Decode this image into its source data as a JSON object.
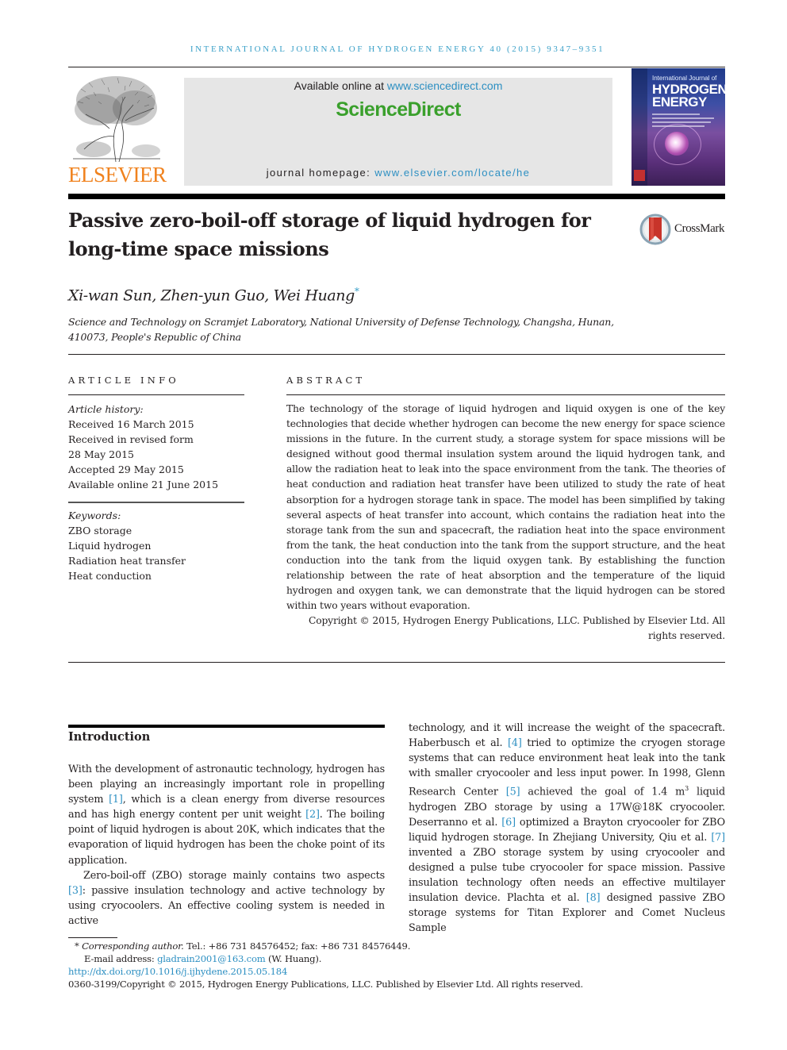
{
  "running_head": "INTERNATIONAL JOURNAL OF HYDROGEN ENERGY 40 (2015) 9347–9351",
  "masthead": {
    "publisher_logo_text": "ELSEVIER",
    "available_online_prefix": "Available online at ",
    "available_online_link": "www.sciencedirect.com",
    "platform_name": "ScienceDirect",
    "homepage_prefix": "journal homepage: ",
    "homepage_link": "www.elsevier.com/locate/he",
    "cover": {
      "line1": "International Journal of",
      "line2": "HYDROGEN",
      "line3": "ENERGY"
    },
    "colors": {
      "publisher_orange": "#f0821e",
      "platform_green": "#3aa02c",
      "link_blue": "#2c8fc2"
    }
  },
  "article": {
    "title": "Passive zero-boil-off storage of liquid hydrogen for long-time space missions",
    "crossmark_label": "CrossMark",
    "authors": "Xi-wan Sun, Zhen-yun Guo, Wei Huang",
    "corresponding_marker": "*",
    "affiliation": "Science and Technology on Scramjet Laboratory, National University of Defense Technology, Changsha, Hunan, 410073, People's Republic of China"
  },
  "article_info": {
    "heading": "ARTICLE INFO",
    "history_label": "Article history:",
    "history": [
      "Received 16 March 2015",
      "Received in revised form",
      "28 May 2015",
      "Accepted 29 May 2015",
      "Available online 21 June 2015"
    ],
    "keywords_label": "Keywords:",
    "keywords": [
      "ZBO storage",
      "Liquid hydrogen",
      "Radiation heat transfer",
      "Heat conduction"
    ]
  },
  "abstract": {
    "heading": "ABSTRACT",
    "body": "The technology of the storage of liquid hydrogen and liquid oxygen is one of the key technologies that decide whether hydrogen can become the new energy for space science missions in the future. In the current study, a storage system for space missions will be designed without good thermal insulation system around the liquid hydrogen tank, and allow the radiation heat to leak into the space environment from the tank. The theories of heat conduction and radiation heat transfer have been utilized to study the rate of heat absorption for a hydrogen storage tank in space. The model has been simplified by taking several aspects of heat transfer into account, which contains the radiation heat into the storage tank from the sun and spacecraft, the radiation heat into the space environment from the tank, the heat conduction into the tank from the support structure, and the heat conduction into the tank from the liquid oxygen tank. By establishing the function relationship between the rate of heat absorption and the temperature of the liquid hydrogen and oxygen tank, we can demonstrate that the liquid hydrogen can be stored within two years without evaporation.",
    "copyright": "Copyright © 2015, Hydrogen Energy Publications, LLC. Published by Elsevier Ltd. All rights reserved."
  },
  "introduction": {
    "heading": "Introduction",
    "left": {
      "p1_a": "With the development of astronautic technology, hydrogen has been playing an increasingly important role in propelling system ",
      "ref1": "[1]",
      "p1_b": ", which is a clean energy from diverse resources and has high energy content per unit weight ",
      "ref2": "[2]",
      "p1_c": ". The boiling point of liquid hydrogen is about 20K, which indicates that the evaporation of liquid hydrogen has been the choke point of its application.",
      "p2_a": "Zero-boil-off (ZBO) storage mainly contains two aspects ",
      "ref3": "[3]",
      "p2_b": ": passive insulation technology and active technology by using cryocoolers. An effective cooling system is needed in active"
    },
    "right": {
      "t1": "technology, and it will increase the weight of the spacecraft. Haberbusch et al. ",
      "ref4": "[4]",
      "t2": " tried to optimize the cryogen storage systems that can reduce environment heat leak into the tank with smaller cryocooler and less input power. In 1998, Glenn Research Center ",
      "ref5": "[5]",
      "t3": " achieved the goal of 1.4 m",
      "sup3": "3",
      "t4": " liquid hydrogen ZBO storage by using a 17W@18K cryocooler. Deserranno et al. ",
      "ref6": "[6]",
      "t5": " optimized a Brayton cryocooler for ZBO liquid hydrogen storage. In Zhejiang University, Qiu et al. ",
      "ref7": "[7]",
      "t6": " invented a ZBO storage system by using cryocooler and designed a pulse tube cryocooler for space mission. Passive insulation technology often needs an effective multilayer insulation device. Plachta et al. ",
      "ref8": "[8]",
      "t7": " designed passive ZBO storage systems for Titan Explorer and Comet Nucleus Sample"
    }
  },
  "footnotes": {
    "marker": "*",
    "corresponding_label": "Corresponding author.",
    "contact": " Tel.: +86 731 84576452; fax: +86 731 84576449.",
    "email_label": "E-mail address: ",
    "email": "gladrain2001@163.com",
    "email_owner": " (W. Huang).",
    "doi": "http://dx.doi.org/10.1016/j.ijhydene.2015.05.184",
    "issn_copyright": "0360-3199/Copyright © 2015, Hydrogen Energy Publications, LLC. Published by Elsevier Ltd. All rights reserved."
  }
}
